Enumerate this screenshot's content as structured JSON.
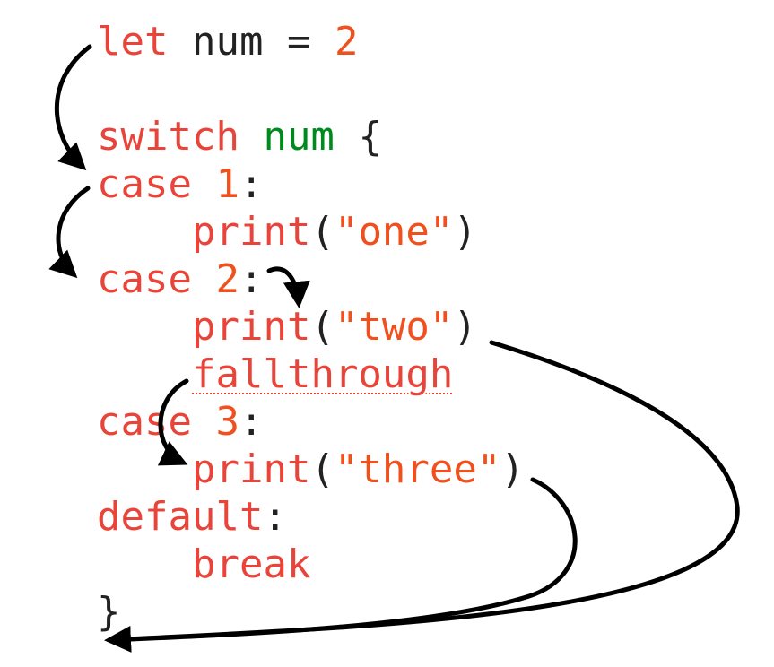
{
  "code": {
    "let_kw": "let",
    "var_name": "num",
    "assign": "=",
    "init_value": "2",
    "switch_kw": "switch",
    "switch_subject": "num",
    "open_brace": "{",
    "case_kw": "case",
    "case1_value": "1",
    "case2_value": "2",
    "case3_value": "3",
    "colon": ":",
    "print_fn": "print",
    "open_paren": "(",
    "close_paren": ")",
    "str_one": "\"one\"",
    "str_two": "\"two\"",
    "str_three": "\"three\"",
    "fallthrough_kw": "fallthrough",
    "default_kw": "default",
    "break_kw": "break",
    "close_brace": "}"
  },
  "colors": {
    "keyword": "#e8443a",
    "literal": "#f0501e",
    "identifier": "#008a1e",
    "punctuation": "#222222",
    "arrow": "#000000"
  }
}
